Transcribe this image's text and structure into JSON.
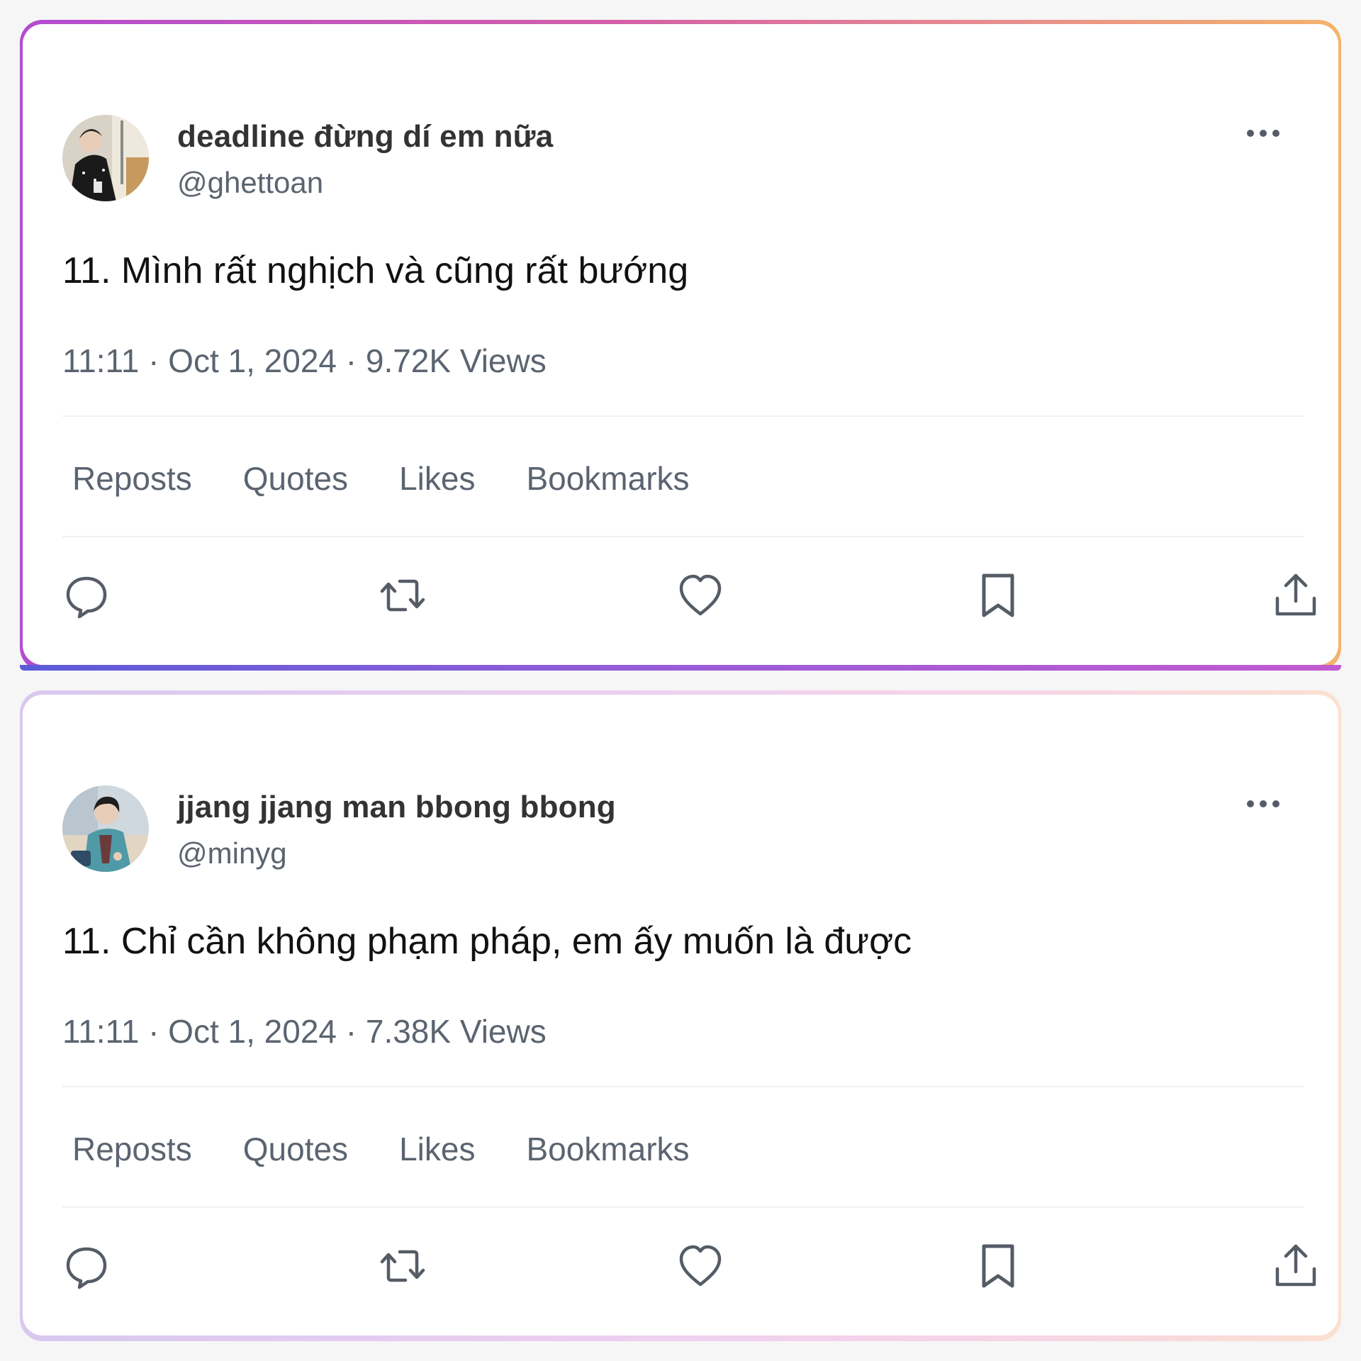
{
  "tweets": [
    {
      "display_name": "deadline đừng dí em nữa",
      "handle": "@ghettoan",
      "text": "11. Mình rất nghịch và cũng rất bướng",
      "meta": "11:11 · Oct 1, 2024 · 9.72K Views",
      "stats": [
        "Reposts",
        "Quotes",
        "Likes",
        "Bookmarks"
      ],
      "avatar": "avatar-photo"
    },
    {
      "display_name": "jjang jjang man bbong bbong",
      "handle": "@minyg",
      "text": "11. Chỉ cần không phạm pháp, em ấy muốn là được",
      "meta": "11:11 · Oct 1, 2024 · 7.38K Views",
      "stats": [
        "Reposts",
        "Quotes",
        "Likes",
        "Bookmarks"
      ],
      "avatar": "avatar-photo"
    }
  ],
  "icons": [
    "more-icon",
    "reply-icon",
    "repost-icon",
    "like-icon",
    "bookmark-icon",
    "share-icon"
  ],
  "colors": {
    "text_primary": "#111111",
    "text_secondary": "#5b6470",
    "divider": "#eff1f3",
    "frame_top_1": "#b44cd0",
    "frame_top_2": "#f4b36a",
    "frame_top_pastel": "#efd0f0"
  }
}
